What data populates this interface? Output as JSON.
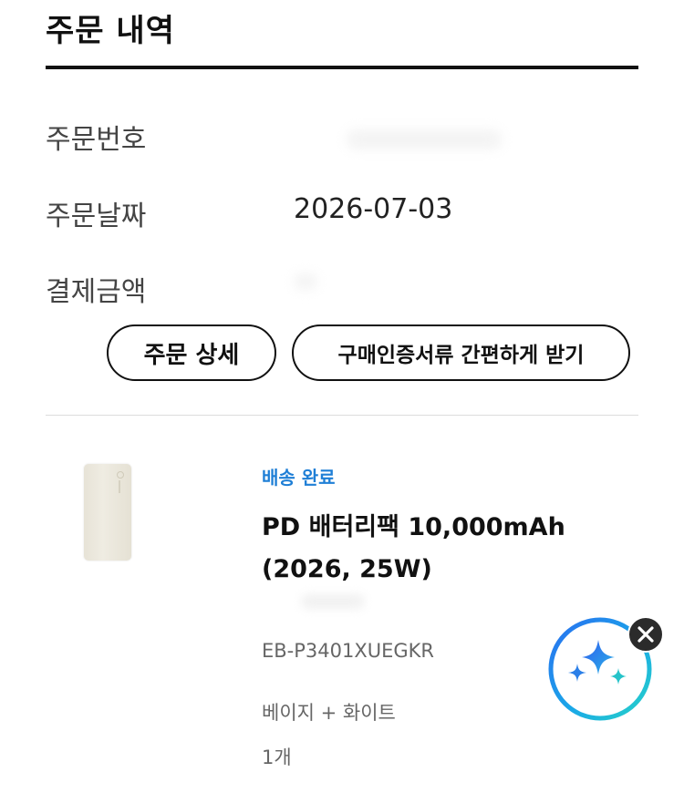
{
  "page": {
    "title": "주문 내역"
  },
  "order_info": {
    "order_number_label": "주문번호",
    "order_date_label": "주문날짜",
    "order_date_value": "2026-07-03",
    "payment_amount_label": "결제금액"
  },
  "actions": {
    "order_detail_label": "주문 상세",
    "receipt_label": "구매인증서류 간편하게 받기"
  },
  "product": {
    "status": "배송 완료",
    "name_line1": "PD 배터리팩 10,000mAh",
    "name_line2": "(2026, 25W)",
    "model": "EB-P3401XUEGKR",
    "option": "베이지 + 화이트",
    "quantity": "1개",
    "image_icon": "battery-pack-icon"
  },
  "ai_assistant": {
    "icon": "sparkle-icon",
    "close_icon": "close-icon"
  },
  "colors": {
    "status_blue": "#1f7fd6",
    "text_dark": "#111111",
    "text_muted": "#666666"
  }
}
